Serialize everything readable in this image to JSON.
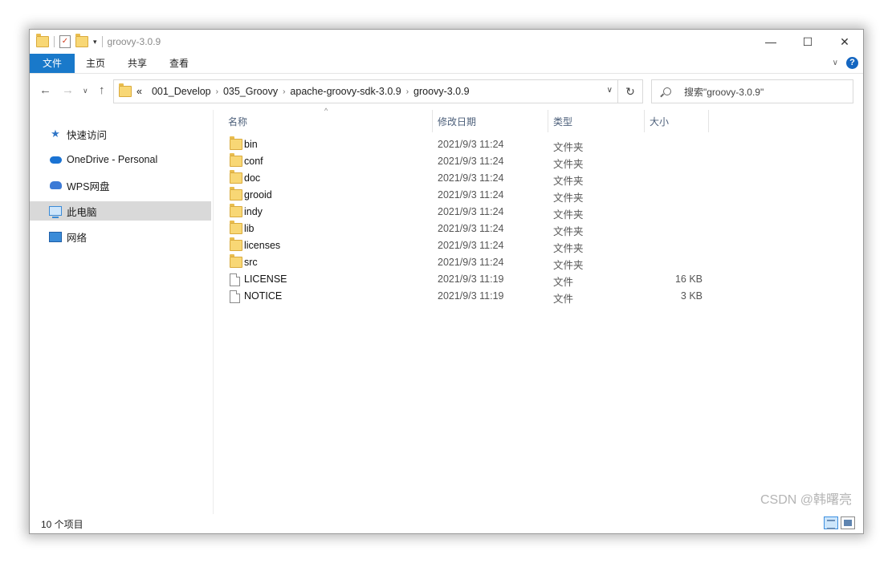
{
  "window": {
    "title": "groovy-3.0.9",
    "controls": {
      "minimize": "—",
      "maximize": "☐",
      "close": "✕"
    }
  },
  "ribbon": {
    "tabs": [
      "文件",
      "主页",
      "共享",
      "查看"
    ]
  },
  "address": {
    "overflow": "«",
    "crumbs": [
      "001_Develop",
      "035_Groovy",
      "apache-groovy-sdk-3.0.9",
      "groovy-3.0.9"
    ]
  },
  "search": {
    "placeholder": "搜索\"groovy-3.0.9\""
  },
  "sidebar": {
    "items": [
      {
        "label": "快速访问",
        "icon": "star-icon"
      },
      {
        "label": "OneDrive - Personal",
        "icon": "cloud-icon"
      },
      {
        "label": "WPS网盘",
        "icon": "wps-cloud-icon"
      },
      {
        "label": "此电脑",
        "icon": "computer-icon",
        "selected": true
      },
      {
        "label": "网络",
        "icon": "network-icon"
      }
    ]
  },
  "columns": {
    "name": "名称",
    "date": "修改日期",
    "type": "类型",
    "size": "大小"
  },
  "files": [
    {
      "name": "bin",
      "date": "2021/9/3 11:24",
      "type": "文件夹",
      "size": "",
      "kind": "folder"
    },
    {
      "name": "conf",
      "date": "2021/9/3 11:24",
      "type": "文件夹",
      "size": "",
      "kind": "folder"
    },
    {
      "name": "doc",
      "date": "2021/9/3 11:24",
      "type": "文件夹",
      "size": "",
      "kind": "folder"
    },
    {
      "name": "grooid",
      "date": "2021/9/3 11:24",
      "type": "文件夹",
      "size": "",
      "kind": "folder"
    },
    {
      "name": "indy",
      "date": "2021/9/3 11:24",
      "type": "文件夹",
      "size": "",
      "kind": "folder"
    },
    {
      "name": "lib",
      "date": "2021/9/3 11:24",
      "type": "文件夹",
      "size": "",
      "kind": "folder"
    },
    {
      "name": "licenses",
      "date": "2021/9/3 11:24",
      "type": "文件夹",
      "size": "",
      "kind": "folder"
    },
    {
      "name": "src",
      "date": "2021/9/3 11:24",
      "type": "文件夹",
      "size": "",
      "kind": "folder"
    },
    {
      "name": "LICENSE",
      "date": "2021/9/3 11:19",
      "type": "文件",
      "size": "16 KB",
      "kind": "file"
    },
    {
      "name": "NOTICE",
      "date": "2021/9/3 11:19",
      "type": "文件",
      "size": "3 KB",
      "kind": "file"
    }
  ],
  "status": {
    "count": "10 个项目"
  },
  "watermark": "CSDN @韩曙亮"
}
